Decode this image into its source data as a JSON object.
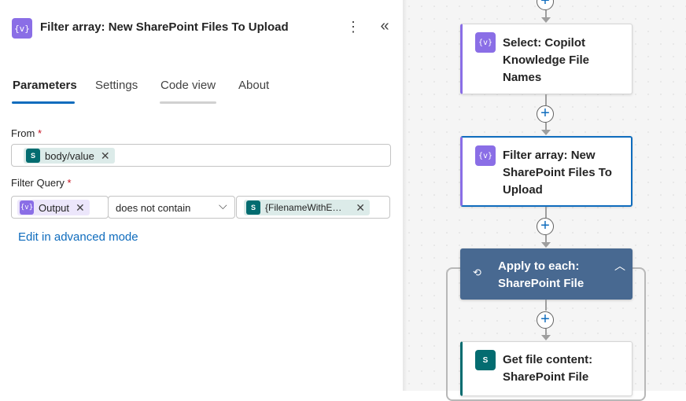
{
  "panel": {
    "title": "Filter array: New SharePoint Files To Upload",
    "header_icon": "{v}",
    "more_icon": "⋮",
    "collapse_icon": "«",
    "tabs": [
      {
        "label": "Parameters",
        "active": true
      },
      {
        "label": "Settings",
        "active": false
      },
      {
        "label": "Code view",
        "active": false
      },
      {
        "label": "About",
        "active": false
      }
    ],
    "from": {
      "label": "From",
      "required": "*",
      "token": {
        "text": "body/value",
        "icon": "sharepoint-icon"
      }
    },
    "filter_query": {
      "label": "Filter Query",
      "required": "*",
      "left_token": {
        "text": "Output",
        "icon": "variable-icon"
      },
      "operator": "does not contain",
      "right_token": {
        "text": "{FilenameWithE…",
        "icon": "sharepoint-icon"
      }
    },
    "advanced_link": "Edit in advanced mode"
  },
  "canvas": {
    "nodes": [
      {
        "title": "Select: Copilot Knowledge File Names",
        "lines": [
          "Select: Copilot",
          "Knowledge File",
          "Names"
        ],
        "icon": "{v}",
        "accent": "#8a6ee6"
      },
      {
        "title": "Filter array: New SharePoint Files To Upload",
        "lines": [
          "Filter array: New",
          "SharePoint Files To",
          "Upload"
        ],
        "icon": "{v}",
        "accent": "#8a6ee6",
        "selected": true
      },
      {
        "title": "Apply to each: SharePoint File",
        "lines": [
          "Apply to each:",
          "SharePoint File"
        ],
        "icon": "loop-icon",
        "accent": "#486991"
      },
      {
        "title": "Get file content: SharePoint File",
        "lines": [
          "Get file content:",
          "SharePoint File"
        ],
        "icon": "sharepoint-icon",
        "accent": "#036c70"
      }
    ],
    "add_action_glyph": "+"
  },
  "colors": {
    "accent_blue": "#0f6cbd",
    "variable_purple": "#8a6ee6",
    "sharepoint_teal": "#036c70",
    "scope_blue": "#486991"
  }
}
